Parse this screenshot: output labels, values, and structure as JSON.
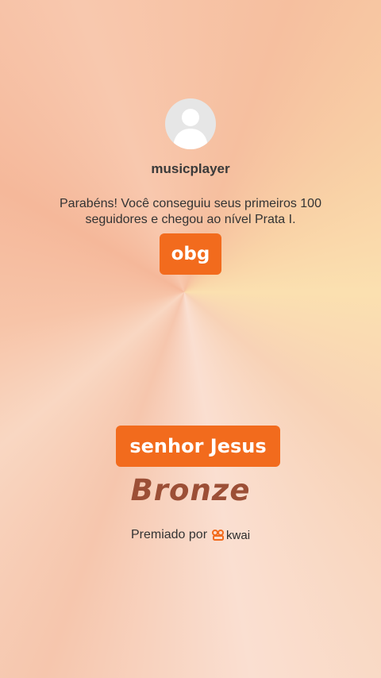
{
  "profile": {
    "username": "musicplayer",
    "avatar_icon": "default-user-icon"
  },
  "message": {
    "text": "Parabéns! Você conseguiu seus primeiros 100 seguidores e chegou ao nível Prata I."
  },
  "reply_button": {
    "label": "obg"
  },
  "award": {
    "name": "senhor Jesus",
    "tier": "Bronze",
    "awarded_by_label": "Premiado por",
    "brand": "kwai",
    "brand_icon": "kwai-logo-icon"
  },
  "colors": {
    "accent": "#f26b1d",
    "tier_text": "#9c4f36",
    "avatar_bg": "#e6e6e6"
  }
}
